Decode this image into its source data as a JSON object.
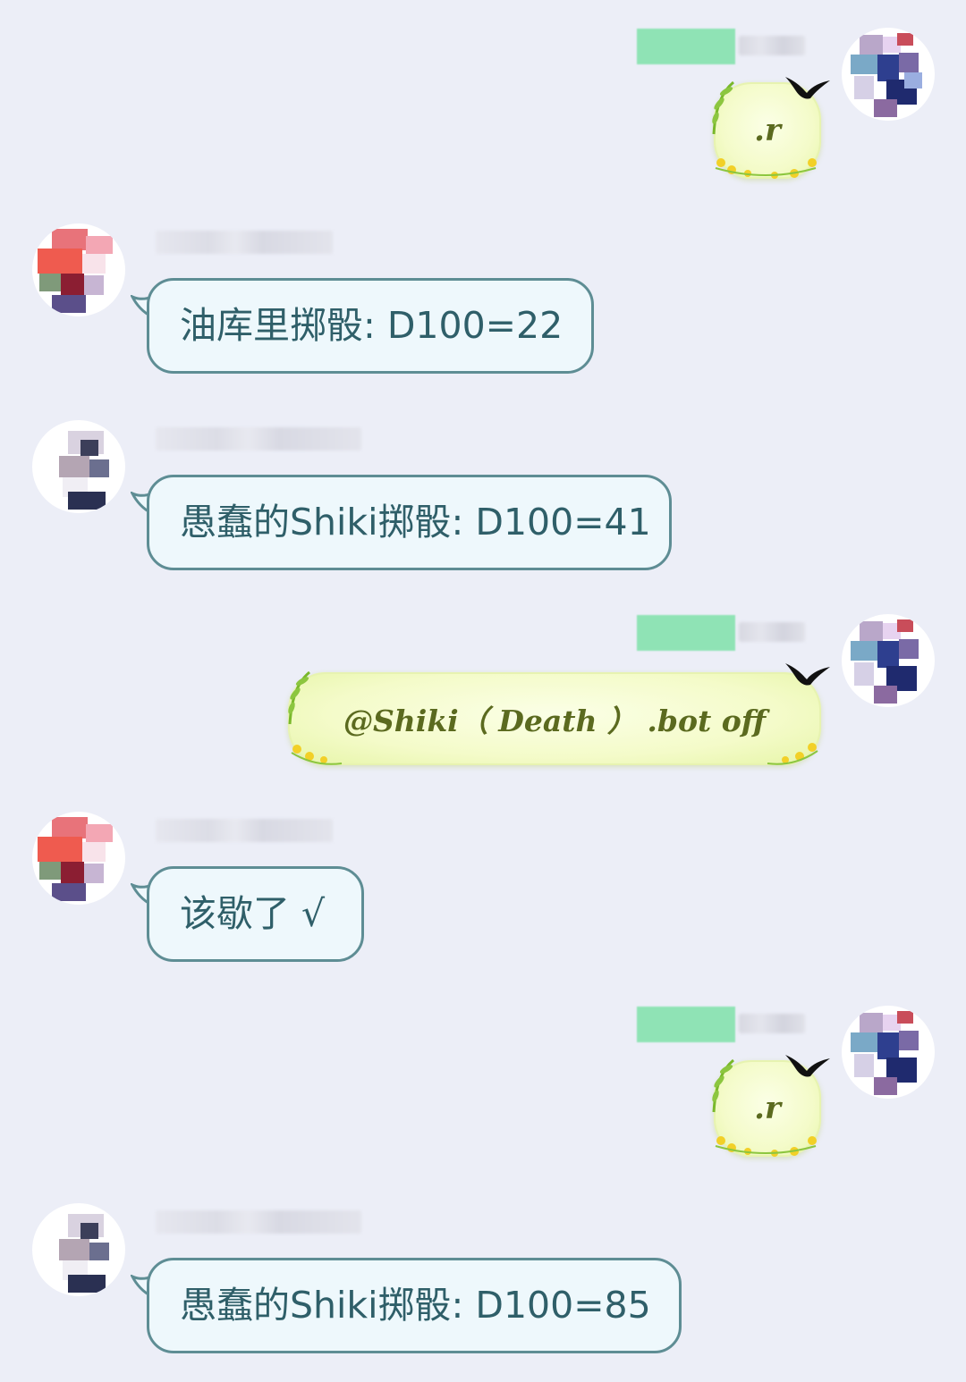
{
  "messages": [
    {
      "side": "right",
      "text": ".r"
    },
    {
      "side": "left",
      "text": "油库里掷骰: D100=22"
    },
    {
      "side": "left",
      "text": "愚蠢的Shiki掷骰: D100=41"
    },
    {
      "side": "right",
      "text": "@Shiki（ Death ） .bot off"
    },
    {
      "side": "left",
      "text": "该歇了 √"
    },
    {
      "side": "right",
      "text": ".r"
    },
    {
      "side": "left",
      "text": "愚蠢的Shiki掷骰: D100=85"
    }
  ],
  "colors": {
    "background": "#eceef7",
    "bubble_border": "#5e8d94",
    "bubble_fill": "#eef8fc",
    "bubble_text": "#2f5f69",
    "fancy_text": "#5b6a1f",
    "sender_tag": "#8fe3b5"
  },
  "icons": [
    "swallow-bird-icon",
    "willow-branch-icon",
    "yellow-flower-icon",
    "speech-tail-icon"
  ]
}
